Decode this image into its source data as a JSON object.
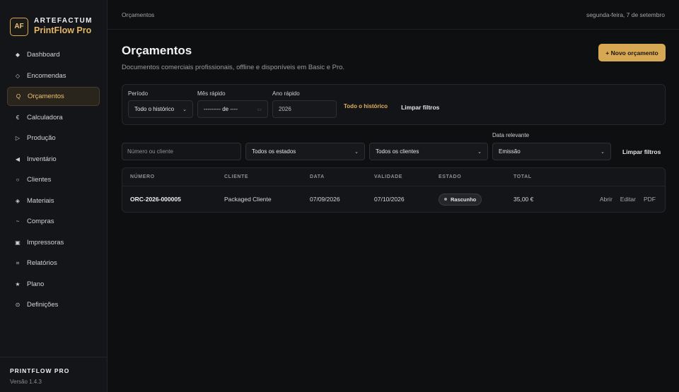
{
  "brand": {
    "logo": "AF",
    "name": "ARTEFACTUM",
    "product": "PrintFlow Pro"
  },
  "nav": [
    {
      "label": "Dashboard",
      "icon": "◆",
      "icon_name": "diamond-icon",
      "active": false
    },
    {
      "label": "Encomendas",
      "icon": "◇",
      "icon_name": "diamond-outline-icon",
      "active": false
    },
    {
      "label": "Orçamentos",
      "icon": "Q",
      "icon_name": "quote-icon",
      "active": true
    },
    {
      "label": "Calculadora",
      "icon": "€",
      "icon_name": "euro-icon",
      "active": false
    },
    {
      "label": "Produção",
      "icon": "▷",
      "icon_name": "play-icon",
      "active": false
    },
    {
      "label": "Inventário",
      "icon": "◀",
      "icon_name": "triangle-left-icon",
      "active": false
    },
    {
      "label": "Clientes",
      "icon": "○",
      "icon_name": "circle-icon",
      "active": false
    },
    {
      "label": "Materiais",
      "icon": "◈",
      "icon_name": "materials-icon",
      "active": false
    },
    {
      "label": "Compras",
      "icon": "~",
      "icon_name": "tilde-icon",
      "active": false
    },
    {
      "label": "Impressoras",
      "icon": "▣",
      "icon_name": "printer-icon",
      "active": false
    },
    {
      "label": "Relatórios",
      "icon": "⌗",
      "icon_name": "reports-icon",
      "active": false
    },
    {
      "label": "Plano",
      "icon": "★",
      "icon_name": "star-icon",
      "active": false
    },
    {
      "label": "Definições",
      "icon": "⊙",
      "icon_name": "settings-icon",
      "active": false
    }
  ],
  "footer": {
    "title": "PRINTFLOW PRO",
    "version": "Versão 1.4.3"
  },
  "topbar": {
    "breadcrumb": "Orçamentos",
    "date": "segunda-feira, 7 de setembro"
  },
  "page": {
    "title": "Orçamentos",
    "subtitle": "Documentos comerciais profissionais, offline e disponíveis em Basic e Pro.",
    "new_button": "+ Novo orçamento"
  },
  "filters": {
    "period_label": "Período",
    "period_value": "Todo o histórico",
    "month_label": "Mês rápido",
    "month_value": "--------- de ----",
    "year_label": "Ano rápido",
    "year_value": "2026",
    "all_history_link": "Todo o histórico",
    "clear_link": "Limpar filtros"
  },
  "filters2": {
    "search_placeholder": "Número ou cliente",
    "status_value": "Todos os estados",
    "clients_value": "Todos os clientes",
    "date_label": "Data relevante",
    "date_value": "Emissão",
    "clear_link": "Limpar filtros"
  },
  "table": {
    "headers": [
      "NÚMERO",
      "CLIENTE",
      "DATA",
      "VALIDADE",
      "ESTADO",
      "TOTAL"
    ],
    "rows": [
      {
        "number": "ORC-2026-000005",
        "client": "Packaged Cliente",
        "date": "07/09/2026",
        "validity": "07/10/2026",
        "status": "Rascunho",
        "total": "35,00 €",
        "actions": [
          "Abrir",
          "Editar",
          "PDF"
        ]
      }
    ]
  },
  "colors": {
    "accent": "#d6a854",
    "background": "#0e0f11",
    "sidebar": "#141518"
  }
}
